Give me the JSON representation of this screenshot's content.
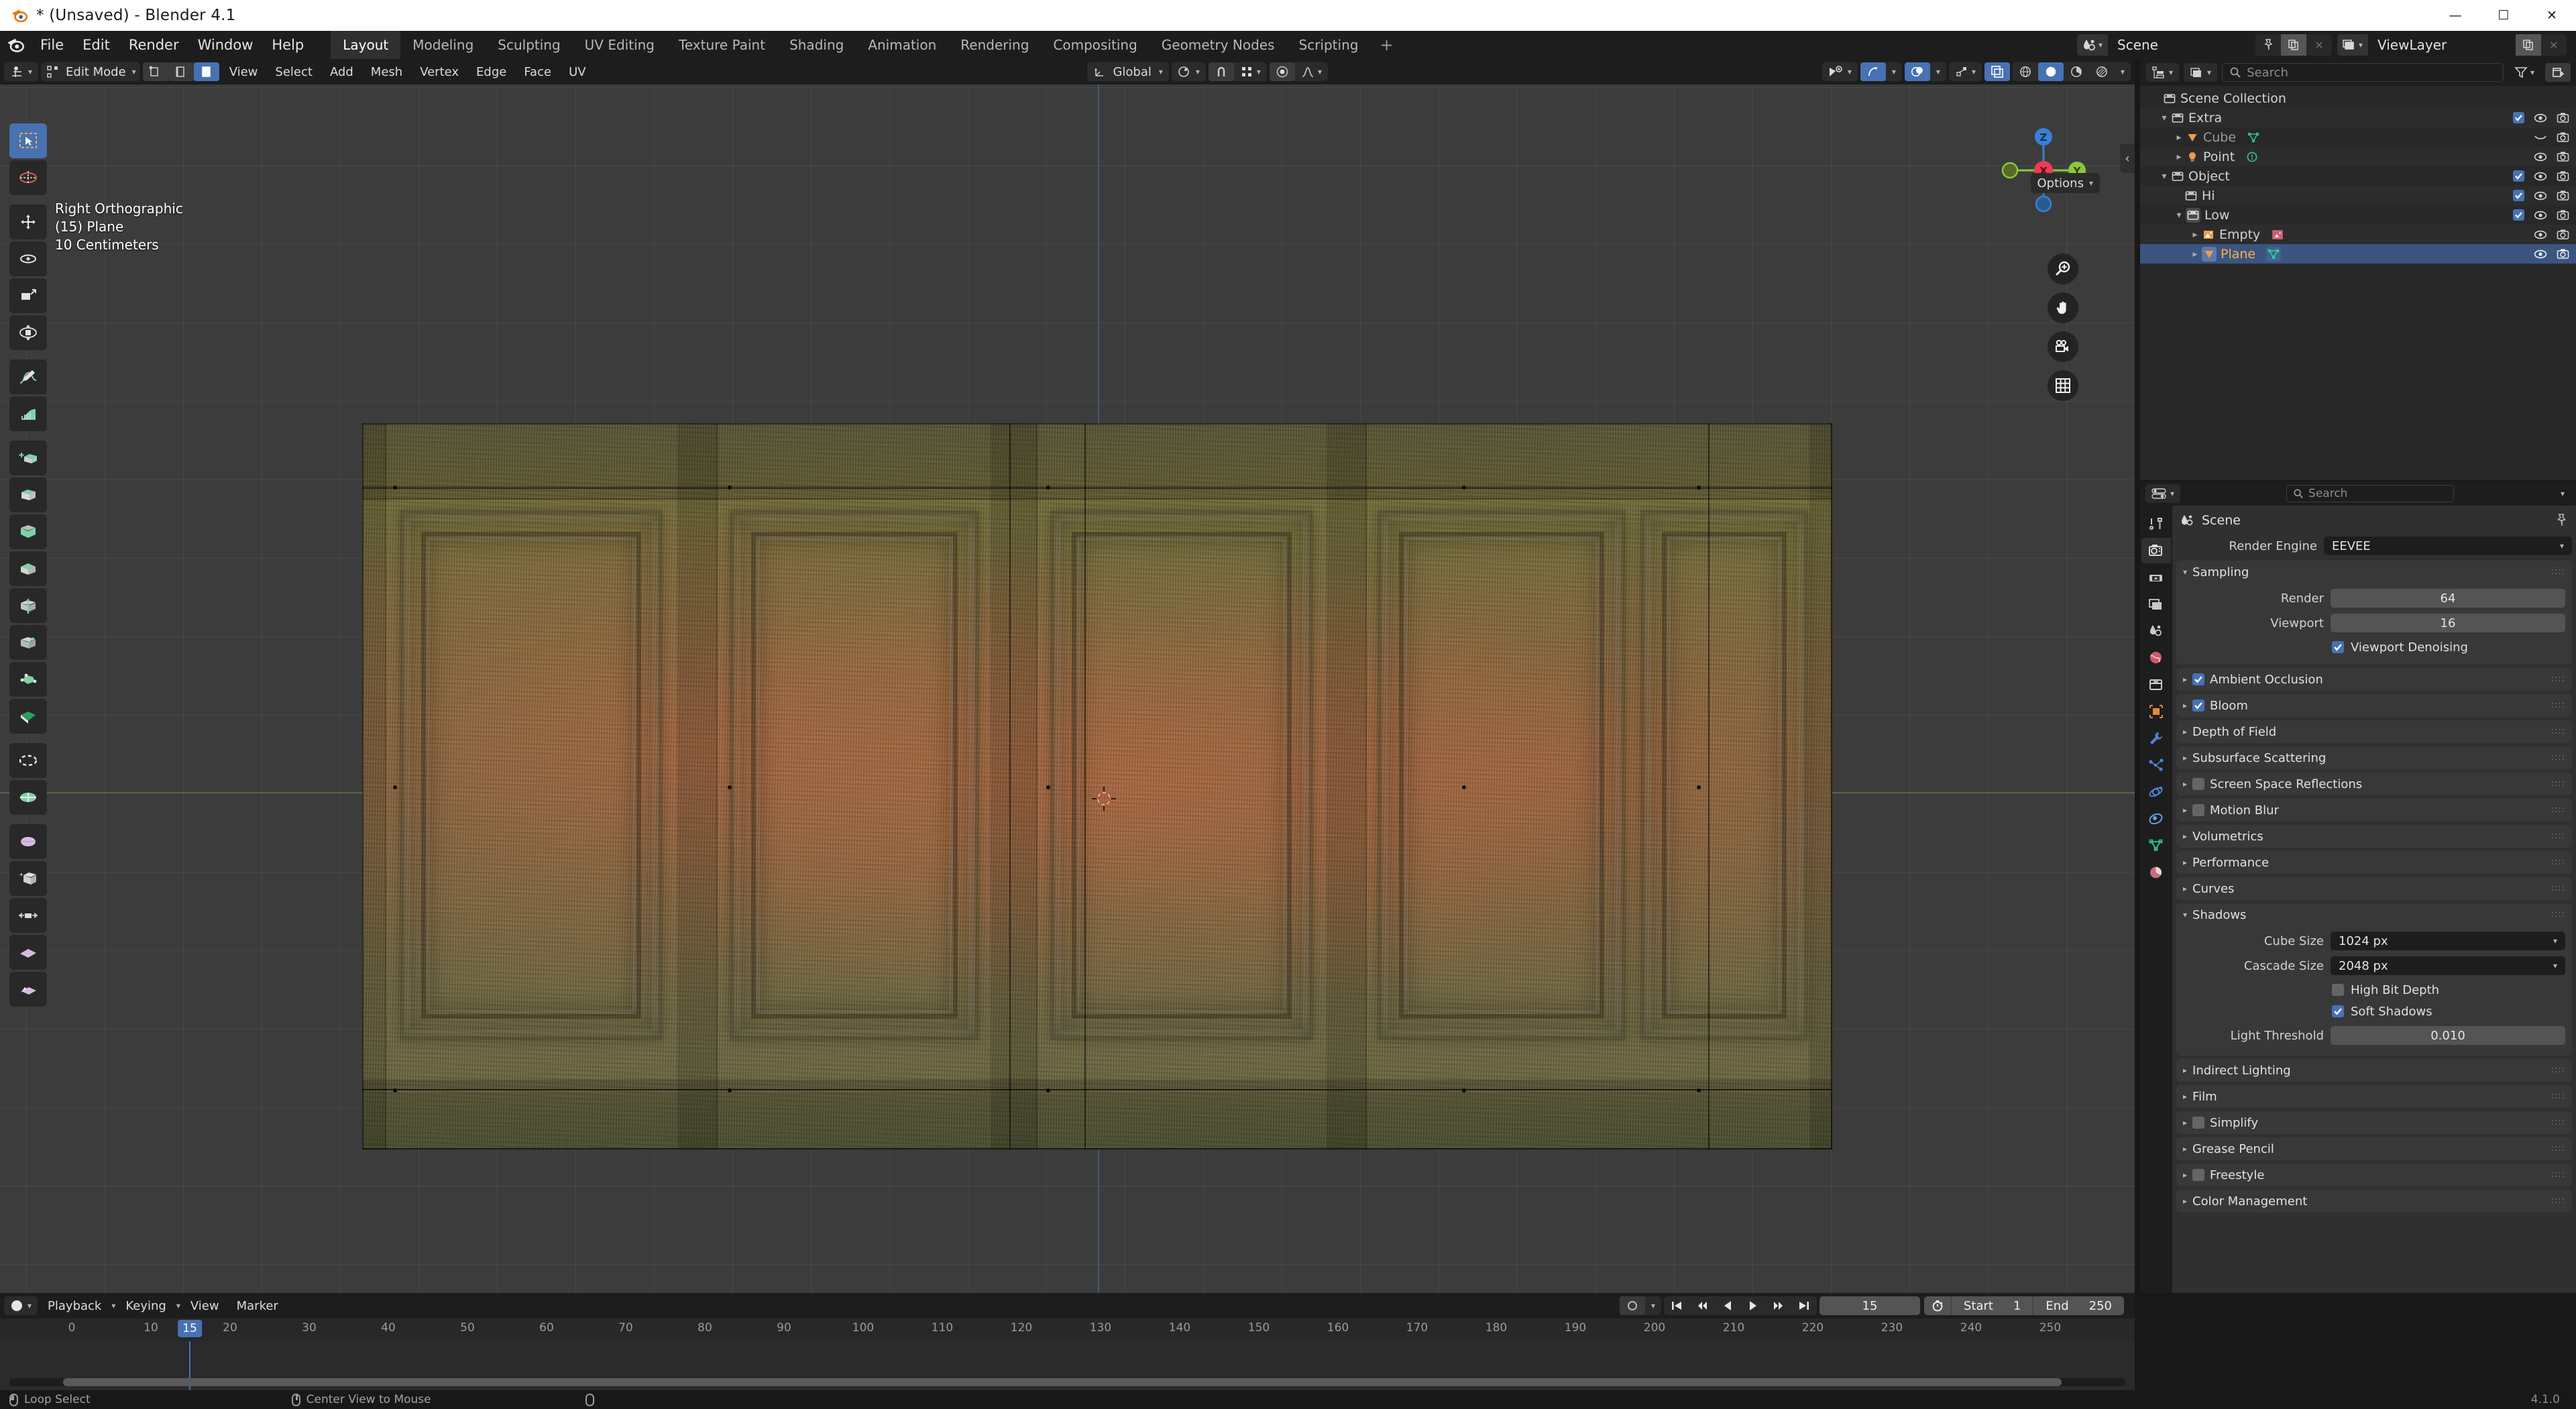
{
  "window": {
    "title": "* (Unsaved) - Blender 4.1",
    "minimize": "—",
    "maximize": "☐",
    "close": "✕"
  },
  "topbar": {
    "menus": [
      "File",
      "Edit",
      "Render",
      "Window",
      "Help"
    ],
    "workspaces": [
      {
        "label": "Layout",
        "active": true
      },
      {
        "label": "Modeling",
        "active": false
      },
      {
        "label": "Sculpting",
        "active": false
      },
      {
        "label": "UV Editing",
        "active": false
      },
      {
        "label": "Texture Paint",
        "active": false
      },
      {
        "label": "Shading",
        "active": false
      },
      {
        "label": "Animation",
        "active": false
      },
      {
        "label": "Rendering",
        "active": false
      },
      {
        "label": "Compositing",
        "active": false
      },
      {
        "label": "Geometry Nodes",
        "active": false
      },
      {
        "label": "Scripting",
        "active": false
      }
    ],
    "add_workspace": "+",
    "scene_name": "Scene",
    "viewlayer_name": "ViewLayer"
  },
  "viewport": {
    "mode": "Edit Mode",
    "menus": [
      "View",
      "Select",
      "Add",
      "Mesh",
      "Vertex",
      "Edge",
      "Face",
      "UV"
    ],
    "transform_orientation": "Global",
    "options_label": "Options",
    "overlay": {
      "view_name": "Right Orthographic",
      "object_name": "(15) Plane",
      "grid_scale": "10 Centimeters"
    },
    "gizmo_axes": {
      "x": "X",
      "y": "Y",
      "z": "Z"
    },
    "select_mode_icons": [
      "vertex-select",
      "edge-select",
      "face-select"
    ],
    "shading_modes": [
      "wireframe",
      "solid",
      "material-preview",
      "rendered"
    ],
    "nav_buttons": [
      "zoom-icon",
      "pan-hand-icon",
      "camera-view-icon",
      "toggle-ortho-grid-icon"
    ],
    "toolbar_tools": [
      "tweak-select-box-tool",
      "cursor-tool",
      "move-tool",
      "rotate-tool",
      "scale-tool",
      "transform-tool",
      "annotate-tool",
      "measure-tool",
      "add-cube-tool",
      "extrude-region-tool",
      "inset-faces-tool",
      "bevel-tool",
      "loop-cut-tool",
      "knife-tool",
      "poly-build-tool",
      "spin-tool",
      "smooth-tool",
      "edge-slide-tool",
      "shrink-fatten-tool",
      "shear-tool",
      "rip-region-tool"
    ]
  },
  "outliner": {
    "search_placeholder": "Search",
    "display_mode_icon": "outliner-display-mode-icon",
    "filter_icon": "filter-icon",
    "new_collection_icon": "new-collection-icon",
    "rows": [
      {
        "label": "Scene Collection",
        "indent": 0,
        "icon": "collection-icon",
        "disclosure": "",
        "selected": false,
        "checkbox": false,
        "eye": false,
        "camera": false
      },
      {
        "label": "Extra",
        "indent": 1,
        "icon": "collection-icon",
        "disclosure": "down",
        "selected": false,
        "checkbox": true,
        "eye": true,
        "camera": true
      },
      {
        "label": "Cube",
        "indent": 2,
        "icon": "mesh-data-icon",
        "disclosure": "right",
        "selected": false,
        "checkbox": false,
        "eye": "hidden",
        "camera": true,
        "dim": true,
        "extra_icon": "mesh-green-icon"
      },
      {
        "label": "Point",
        "indent": 2,
        "icon": "light-icon",
        "disclosure": "right",
        "selected": false,
        "checkbox": false,
        "eye": true,
        "camera": true,
        "extra_icon": "light-data-icon"
      },
      {
        "label": "Object",
        "indent": 1,
        "icon": "collection-icon",
        "disclosure": "down",
        "selected": false,
        "checkbox": true,
        "eye": true,
        "camera": true
      },
      {
        "label": "Hi",
        "indent": 2,
        "icon": "collection-icon",
        "disclosure": "",
        "selected": false,
        "checkbox": true,
        "eye": true,
        "camera": true
      },
      {
        "label": "Low",
        "indent": 2,
        "icon": "collection-icon",
        "disclosure": "down",
        "selected": false,
        "checkbox": true,
        "eye": true,
        "camera": true
      },
      {
        "label": "Empty",
        "indent": 3,
        "icon": "empty-image-icon",
        "disclosure": "right",
        "selected": false,
        "checkbox": false,
        "eye": true,
        "camera": true,
        "extra_icon": "image-data-icon"
      },
      {
        "label": "Plane",
        "indent": 3,
        "icon": "mesh-data-icon",
        "disclosure": "right",
        "selected": true,
        "checkbox": false,
        "eye": true,
        "camera": true,
        "extra_icon": "mesh-green-icon"
      }
    ]
  },
  "properties": {
    "search_placeholder": "Search",
    "context_name": "Scene",
    "active_tab": "render-properties-tab",
    "tabs": [
      "tool-properties-tab",
      "render-properties-tab",
      "output-properties-tab",
      "view-layer-properties-tab",
      "scene-properties-tab",
      "world-properties-tab",
      "collection-properties-tab",
      "object-properties-tab",
      "modifier-properties-tab",
      "particle-properties-tab",
      "physics-properties-tab",
      "object-constraint-properties-tab",
      "object-data-properties-tab",
      "material-properties-tab"
    ],
    "render_engine_label": "Render Engine",
    "render_engine_value": "EEVEE",
    "sampling": {
      "title": "Sampling",
      "render_label": "Render",
      "render_value": "64",
      "viewport_label": "Viewport",
      "viewport_value": "16",
      "denoise_label": "Viewport Denoising",
      "denoise_checked": true
    },
    "panels": [
      {
        "label": "Ambient Occlusion",
        "checkbox": true,
        "checked": true,
        "open": false
      },
      {
        "label": "Bloom",
        "checkbox": true,
        "checked": true,
        "open": false
      },
      {
        "label": "Depth of Field",
        "checkbox": false,
        "checked": false,
        "open": false
      },
      {
        "label": "Subsurface Scattering",
        "checkbox": false,
        "checked": false,
        "open": false
      },
      {
        "label": "Screen Space Reflections",
        "checkbox": true,
        "checked": false,
        "open": false
      },
      {
        "label": "Motion Blur",
        "checkbox": true,
        "checked": false,
        "open": false
      },
      {
        "label": "Volumetrics",
        "checkbox": false,
        "checked": false,
        "open": false
      },
      {
        "label": "Performance",
        "checkbox": false,
        "checked": false,
        "open": false
      },
      {
        "label": "Curves",
        "checkbox": false,
        "checked": false,
        "open": false
      }
    ],
    "shadows": {
      "title": "Shadows",
      "cube_size_label": "Cube Size",
      "cube_size_value": "1024 px",
      "cascade_size_label": "Cascade Size",
      "cascade_size_value": "2048 px",
      "high_bit_depth_label": "High Bit Depth",
      "high_bit_depth_checked": false,
      "soft_shadows_label": "Soft Shadows",
      "soft_shadows_checked": true,
      "light_threshold_label": "Light Threshold",
      "light_threshold_value": "0.010"
    },
    "panels_after": [
      {
        "label": "Indirect Lighting",
        "checkbox": false,
        "checked": false
      },
      {
        "label": "Film",
        "checkbox": false,
        "checked": false
      },
      {
        "label": "Simplify",
        "checkbox": true,
        "checked": false
      },
      {
        "label": "Grease Pencil",
        "checkbox": false,
        "checked": false
      },
      {
        "label": "Freestyle",
        "checkbox": true,
        "checked": false
      },
      {
        "label": "Color Management",
        "checkbox": false,
        "checked": false
      }
    ]
  },
  "timeline": {
    "menus": [
      "Playback",
      "Keying",
      "View",
      "Marker"
    ],
    "ticks": [
      {
        "label": "0",
        "frame": 0
      },
      {
        "label": "10",
        "frame": 10
      },
      {
        "label": "20",
        "frame": 20
      },
      {
        "label": "30",
        "frame": 30
      },
      {
        "label": "40",
        "frame": 40
      },
      {
        "label": "50",
        "frame": 50
      },
      {
        "label": "60",
        "frame": 60
      },
      {
        "label": "70",
        "frame": 70
      },
      {
        "label": "80",
        "frame": 80
      },
      {
        "label": "90",
        "frame": 90
      },
      {
        "label": "100",
        "frame": 100
      },
      {
        "label": "110",
        "frame": 110
      },
      {
        "label": "120",
        "frame": 120
      },
      {
        "label": "130",
        "frame": 130
      },
      {
        "label": "140",
        "frame": 140
      },
      {
        "label": "150",
        "frame": 150
      },
      {
        "label": "160",
        "frame": 160
      },
      {
        "label": "170",
        "frame": 170
      },
      {
        "label": "180",
        "frame": 180
      },
      {
        "label": "190",
        "frame": 190
      },
      {
        "label": "200",
        "frame": 200
      },
      {
        "label": "210",
        "frame": 210
      },
      {
        "label": "220",
        "frame": 220
      },
      {
        "label": "230",
        "frame": 230
      },
      {
        "label": "240",
        "frame": 240
      },
      {
        "label": "250",
        "frame": 250
      }
    ],
    "current_frame": "15",
    "current_frame_num": 15,
    "start_label": "Start",
    "start_value": "1",
    "end_label": "End",
    "end_value": "250",
    "playback_buttons": [
      "jump-to-start",
      "jump-prev-keyframe",
      "play-reverse",
      "play",
      "jump-next-keyframe",
      "jump-to-end"
    ]
  },
  "statusbar": {
    "items": [
      {
        "mouse": "left",
        "label": "Loop Select"
      },
      {
        "mouse": "middle",
        "label": "Center View to Mouse"
      },
      {
        "mouse": "right",
        "label": ""
      }
    ],
    "version": "4.1.0"
  },
  "colors": {
    "accent_blue": "#4772b3",
    "selected_orange": "#ffb13b",
    "bg_dark": "#1d1d1d",
    "bg_panel": "#303030",
    "viewport_bg": "#3c3c3c"
  }
}
